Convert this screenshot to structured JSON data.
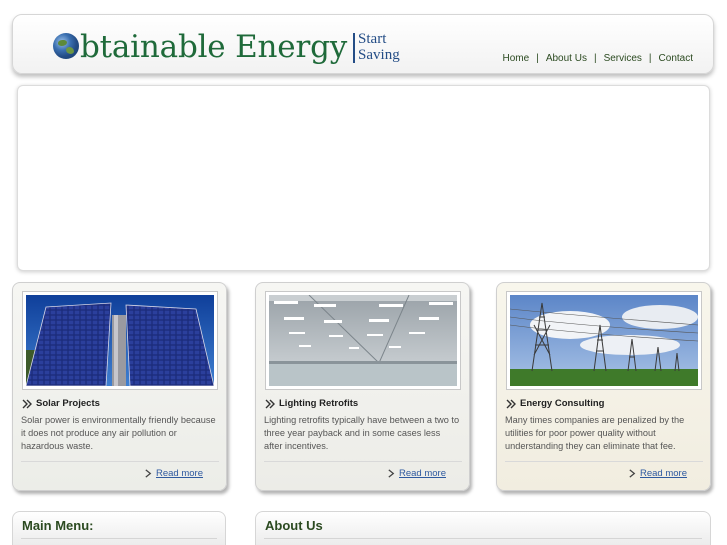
{
  "header": {
    "logo_text": "btainable Energy",
    "tagline_1": "Start",
    "tagline_2": "Saving"
  },
  "nav": {
    "items": [
      "Home",
      "About Us",
      "Services",
      "Contact"
    ],
    "separator": "|"
  },
  "cards": [
    {
      "title": "Solar Projects",
      "text": "Solar power is environmentally friendly because it does not produce any air pollution or hazardous waste.",
      "link": "Read more",
      "image": "solar-panels"
    },
    {
      "title": "Lighting Retrofits",
      "text": "Lighting retrofits typically have between a two to three year payback and in some cases less after incentives.",
      "link": "Read more",
      "image": "warehouse-lights"
    },
    {
      "title": "Energy Consulting",
      "text": "Many times companies are penalized by the utilities for poor power quality without understanding they can eliminate that fee.",
      "link": "Read more",
      "image": "power-lines"
    }
  ],
  "sections": {
    "main_menu": "Main Menu:",
    "about_us": "About Us"
  },
  "colors": {
    "brand_green": "#1f6a3a",
    "tagline_blue": "#244d86",
    "link_blue": "#2f5aa0"
  }
}
